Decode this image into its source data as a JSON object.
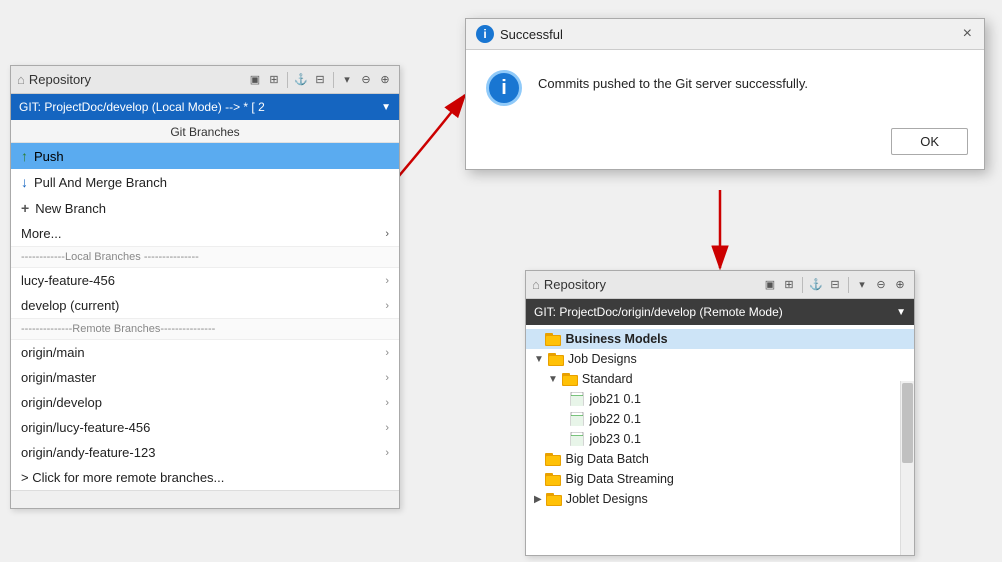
{
  "left_panel": {
    "title": "Repository",
    "branch_label": "GIT: ProjectDoc/develop   (Local Mode)    -->  * [ 2",
    "git_branches_label": "Git Branches",
    "menu_items": [
      {
        "id": "push",
        "icon": "↑",
        "label": "Push",
        "active": true
      },
      {
        "id": "pull",
        "icon": "↓",
        "label": "Pull And Merge Branch",
        "active": false
      },
      {
        "id": "new-branch",
        "icon": "+",
        "label": "New Branch",
        "active": false
      },
      {
        "id": "more",
        "icon": "",
        "label": "More...",
        "has_arrow": true,
        "active": false
      }
    ],
    "local_divider": "------------Local   Branches ---------------",
    "local_branches": [
      {
        "label": "lucy-feature-456",
        "has_arrow": true
      },
      {
        "label": "develop (current)",
        "has_arrow": true
      }
    ],
    "remote_divider": "--------------Remote Branches---------------",
    "remote_branches": [
      {
        "label": "origin/main",
        "has_arrow": true
      },
      {
        "label": "origin/master",
        "has_arrow": true
      },
      {
        "label": "origin/develop",
        "has_arrow": true
      },
      {
        "label": "origin/lucy-feature-456",
        "has_arrow": true
      },
      {
        "label": "origin/andy-feature-123",
        "has_arrow": true
      },
      {
        "label": "> Click for more remote branches...",
        "has_arrow": false
      }
    ]
  },
  "dialog": {
    "title": "Successful",
    "message": "Commits pushed to the Git server successfully.",
    "ok_label": "OK",
    "close_label": "×"
  },
  "right_panel": {
    "title": "Repository",
    "branch_label": "GIT: ProjectDoc/origin/develop   (Remote Mode)",
    "tree": [
      {
        "indent": 0,
        "expand": "",
        "icon": "folder",
        "label": "Business Models",
        "selected": true
      },
      {
        "indent": 0,
        "expand": "▼",
        "icon": "folder",
        "label": "Job Designs",
        "selected": false
      },
      {
        "indent": 1,
        "expand": "▼",
        "icon": "folder",
        "label": "Standard",
        "selected": false
      },
      {
        "indent": 2,
        "expand": "",
        "icon": "file",
        "label": "job21 0.1",
        "selected": false
      },
      {
        "indent": 2,
        "expand": "",
        "icon": "file",
        "label": "job22 0.1",
        "selected": false
      },
      {
        "indent": 2,
        "expand": "",
        "icon": "file",
        "label": "job23 0.1",
        "selected": false
      },
      {
        "indent": 0,
        "expand": "",
        "icon": "folder",
        "label": "Big Data Batch",
        "selected": false
      },
      {
        "indent": 0,
        "expand": "",
        "icon": "folder",
        "label": "Big Data Streaming",
        "selected": false
      },
      {
        "indent": 0,
        "expand": "▶",
        "icon": "folder",
        "label": "Joblet Designs",
        "selected": false
      }
    ]
  }
}
